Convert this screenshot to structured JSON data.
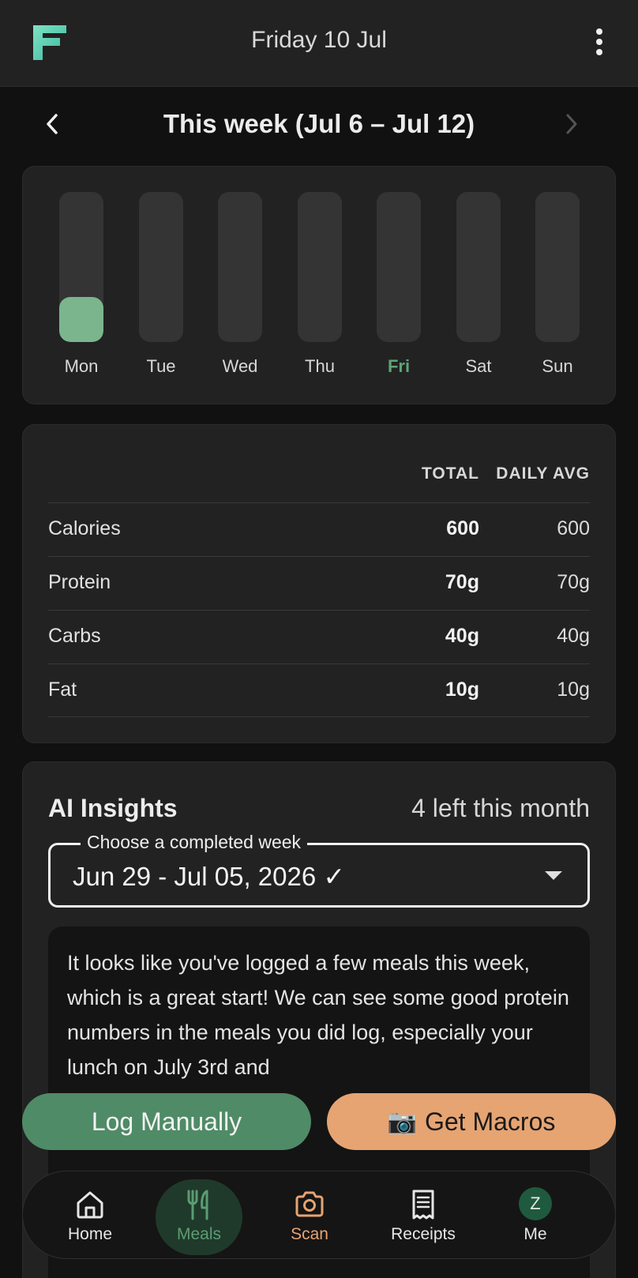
{
  "header": {
    "date": "Friday 10 Jul"
  },
  "week_nav": {
    "title": "This week (Jul 6 – Jul 12)"
  },
  "week_bars": {
    "days": [
      {
        "label": "Mon",
        "fill": 0.3,
        "today": false
      },
      {
        "label": "Tue",
        "fill": 0,
        "today": false
      },
      {
        "label": "Wed",
        "fill": 0,
        "today": false
      },
      {
        "label": "Thu",
        "fill": 0,
        "today": false
      },
      {
        "label": "Fri",
        "fill": 0,
        "today": true
      },
      {
        "label": "Sat",
        "fill": 0,
        "today": false
      },
      {
        "label": "Sun",
        "fill": 0,
        "today": false
      }
    ]
  },
  "macros": {
    "col_total": "TOTAL",
    "col_avg": "DAILY AVG",
    "rows": [
      {
        "name": "Calories",
        "total": "600",
        "avg": "600"
      },
      {
        "name": "Protein",
        "total": "70g",
        "avg": "70g"
      },
      {
        "name": "Carbs",
        "total": "40g",
        "avg": "40g"
      },
      {
        "name": "Fat",
        "total": "10g",
        "avg": "10g"
      }
    ]
  },
  "ai_insights": {
    "title": "AI Insights",
    "remaining": "4 left this month",
    "select_legend": "Choose a completed week",
    "selected_week": "Jun 29 - Jul 05, 2026 ✓",
    "text": "It looks like you've logged a few meals this week, which is a great start! We can see some good protein numbers in the meals you did log, especially your lunch on July 3rd and"
  },
  "actions": {
    "log_manually": "Log Manually",
    "get_macros_icon": "📷",
    "get_macros": "Get Macros"
  },
  "nav": {
    "home": "Home",
    "meals": "Meals",
    "scan": "Scan",
    "receipts": "Receipts",
    "me": "Me",
    "avatar_initial": "Z"
  },
  "colors": {
    "accent_green": "#4f8b66",
    "accent_orange": "#e6a472",
    "bar_fill": "#7bb58e"
  }
}
